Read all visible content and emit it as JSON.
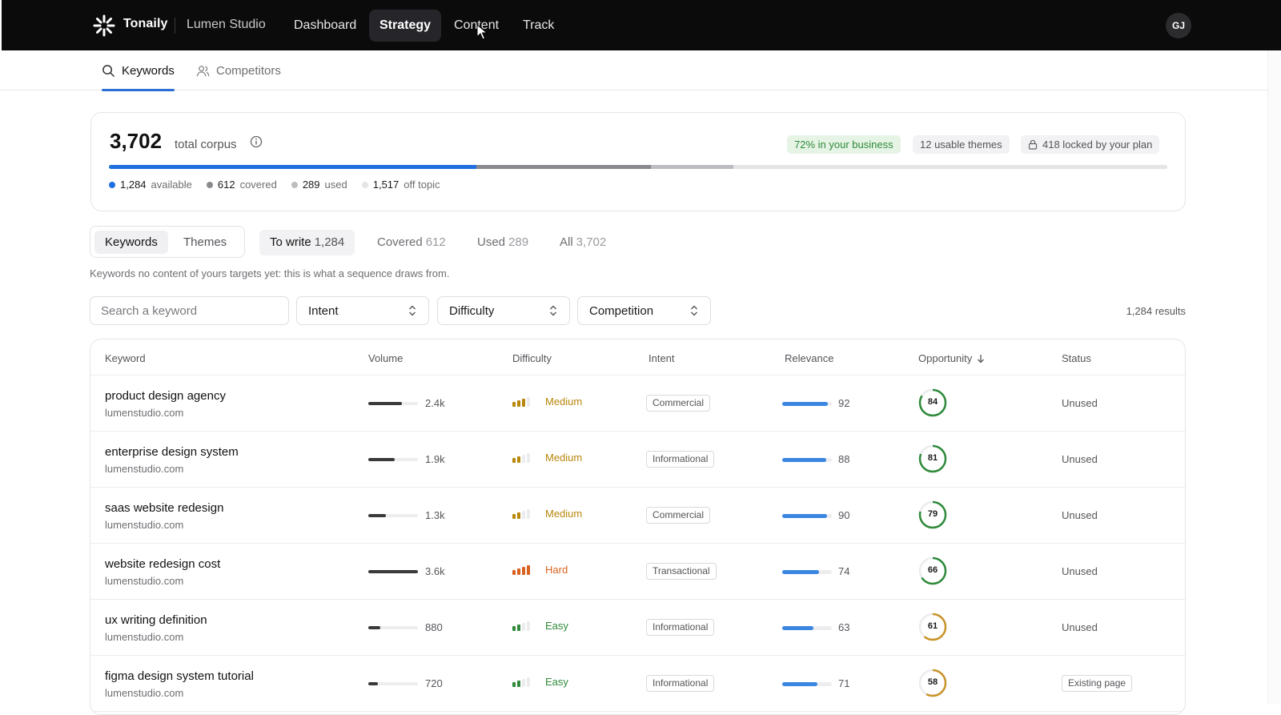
{
  "topbar": {
    "brand": "Tonaily",
    "workspace": "Lumen Studio",
    "nav": [
      {
        "label": "Dashboard",
        "active": false
      },
      {
        "label": "Strategy",
        "active": true
      },
      {
        "label": "Content",
        "active": false
      },
      {
        "label": "Track",
        "active": false
      }
    ],
    "avatar_initials": "GJ"
  },
  "subnav": {
    "tabs": [
      {
        "label": "Keywords",
        "icon": "search-icon",
        "active": true
      },
      {
        "label": "Competitors",
        "icon": "users-icon",
        "active": false
      }
    ]
  },
  "corpus": {
    "total": "3,702",
    "total_label": "total corpus",
    "chips": {
      "business": "72% in your business",
      "themes": "12 usable themes",
      "locked": "418 locked by your plan"
    },
    "legend": [
      {
        "value": "1,284",
        "label": "available",
        "color": "#1f6fe0"
      },
      {
        "value": "612",
        "label": "covered",
        "color": "#8a8a8e"
      },
      {
        "value": "289",
        "label": "used",
        "color": "#bdbdc1"
      },
      {
        "value": "1,517",
        "label": "off topic",
        "color": "#e4e4e7"
      }
    ]
  },
  "view": {
    "segments": [
      {
        "label": "Keywords",
        "active": true
      },
      {
        "label": "Themes",
        "active": false
      }
    ],
    "filters": [
      {
        "label": "To write",
        "count": "1,284",
        "active": true
      },
      {
        "label": "Covered",
        "count": "612",
        "active": false
      },
      {
        "label": "Used",
        "count": "289",
        "active": false
      },
      {
        "label": "All",
        "count": "3,702",
        "active": false
      }
    ],
    "hint": "Keywords no content of yours targets yet: this is what a sequence draws from."
  },
  "toolbar": {
    "search_placeholder": "Search a keyword",
    "selects": [
      "Intent",
      "Difficulty",
      "Competition"
    ],
    "results": "1,284 results"
  },
  "table": {
    "columns": [
      "Keyword",
      "Volume",
      "Difficulty",
      "Intent",
      "Relevance",
      "Opportunity",
      "Status"
    ],
    "difficulty_colors": {
      "Medium": "#b8860b",
      "Hard": "#d9621f",
      "Easy": "#2f8a3a"
    },
    "rows": [
      {
        "keyword": "product design agency",
        "domain": "lumenstudio.com",
        "volume": "2.4k",
        "volume_level": 0.67,
        "difficulty": "Medium",
        "difficulty_level": 3,
        "intent": "Commercial",
        "relevance": "92",
        "relevance_level": 0.92,
        "opportunity": "84",
        "opportunity_level": 0.84,
        "status": "Unused",
        "status_pill": false
      },
      {
        "keyword": "enterprise design system",
        "domain": "lumenstudio.com",
        "volume": "1.9k",
        "volume_level": 0.53,
        "difficulty": "Medium",
        "difficulty_level": 2,
        "intent": "Informational",
        "relevance": "88",
        "relevance_level": 0.88,
        "opportunity": "81",
        "opportunity_level": 0.81,
        "status": "Unused",
        "status_pill": false
      },
      {
        "keyword": "saas website redesign",
        "domain": "lumenstudio.com",
        "volume": "1.3k",
        "volume_level": 0.36,
        "difficulty": "Medium",
        "difficulty_level": 2,
        "intent": "Commercial",
        "relevance": "90",
        "relevance_level": 0.9,
        "opportunity": "79",
        "opportunity_level": 0.79,
        "status": "Unused",
        "status_pill": false
      },
      {
        "keyword": "website redesign cost",
        "domain": "lumenstudio.com",
        "volume": "3.6k",
        "volume_level": 1.0,
        "difficulty": "Hard",
        "difficulty_level": 4,
        "intent": "Transactional",
        "relevance": "74",
        "relevance_level": 0.74,
        "opportunity": "66",
        "opportunity_level": 0.66,
        "status": "Unused",
        "status_pill": false
      },
      {
        "keyword": "ux writing definition",
        "domain": "lumenstudio.com",
        "volume": "880",
        "volume_level": 0.24,
        "difficulty": "Easy",
        "difficulty_level": 2,
        "intent": "Informational",
        "relevance": "63",
        "relevance_level": 0.63,
        "opportunity": "61",
        "opportunity_level": 0.61,
        "status": "Unused",
        "status_pill": false
      },
      {
        "keyword": "figma design system tutorial",
        "domain": "lumenstudio.com",
        "volume": "720",
        "volume_level": 0.2,
        "difficulty": "Easy",
        "difficulty_level": 2,
        "intent": "Informational",
        "relevance": "71",
        "relevance_level": 0.71,
        "opportunity": "58",
        "opportunity_level": 0.58,
        "status": "Existing page",
        "status_pill": true
      }
    ]
  }
}
